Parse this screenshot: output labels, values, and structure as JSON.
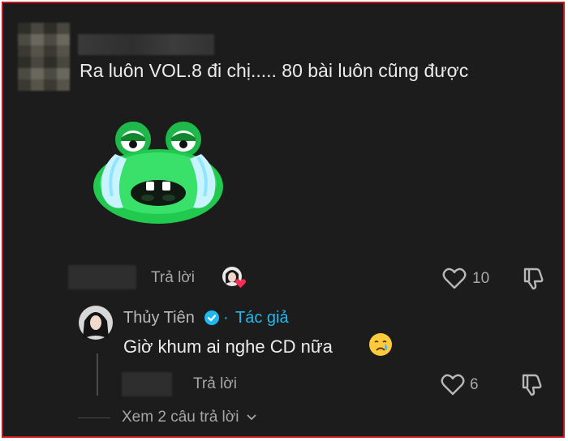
{
  "comment": {
    "username": "",
    "text": "Ra luôn VOL.8 đi chị..... 80 bài luôn cũng được",
    "sticker_icon": "crying-frog-sticker",
    "reply_label": "Trả lời",
    "like_count": "10"
  },
  "reply": {
    "name": "Thủy Tiên",
    "badge_separator": "·",
    "author_label": "Tác giả",
    "text": "Giờ khum ai nghe CD nữa",
    "emoji": "crying-face-icon",
    "reply_label": "Trả lời",
    "like_count": "6"
  },
  "view_more": {
    "label": "Xem 2 câu trả lời"
  },
  "colors": {
    "background": "#1c1c1c",
    "frame_border": "#c8161e",
    "accent": "#21b8f0",
    "muted_text": "#a7a7a7"
  }
}
